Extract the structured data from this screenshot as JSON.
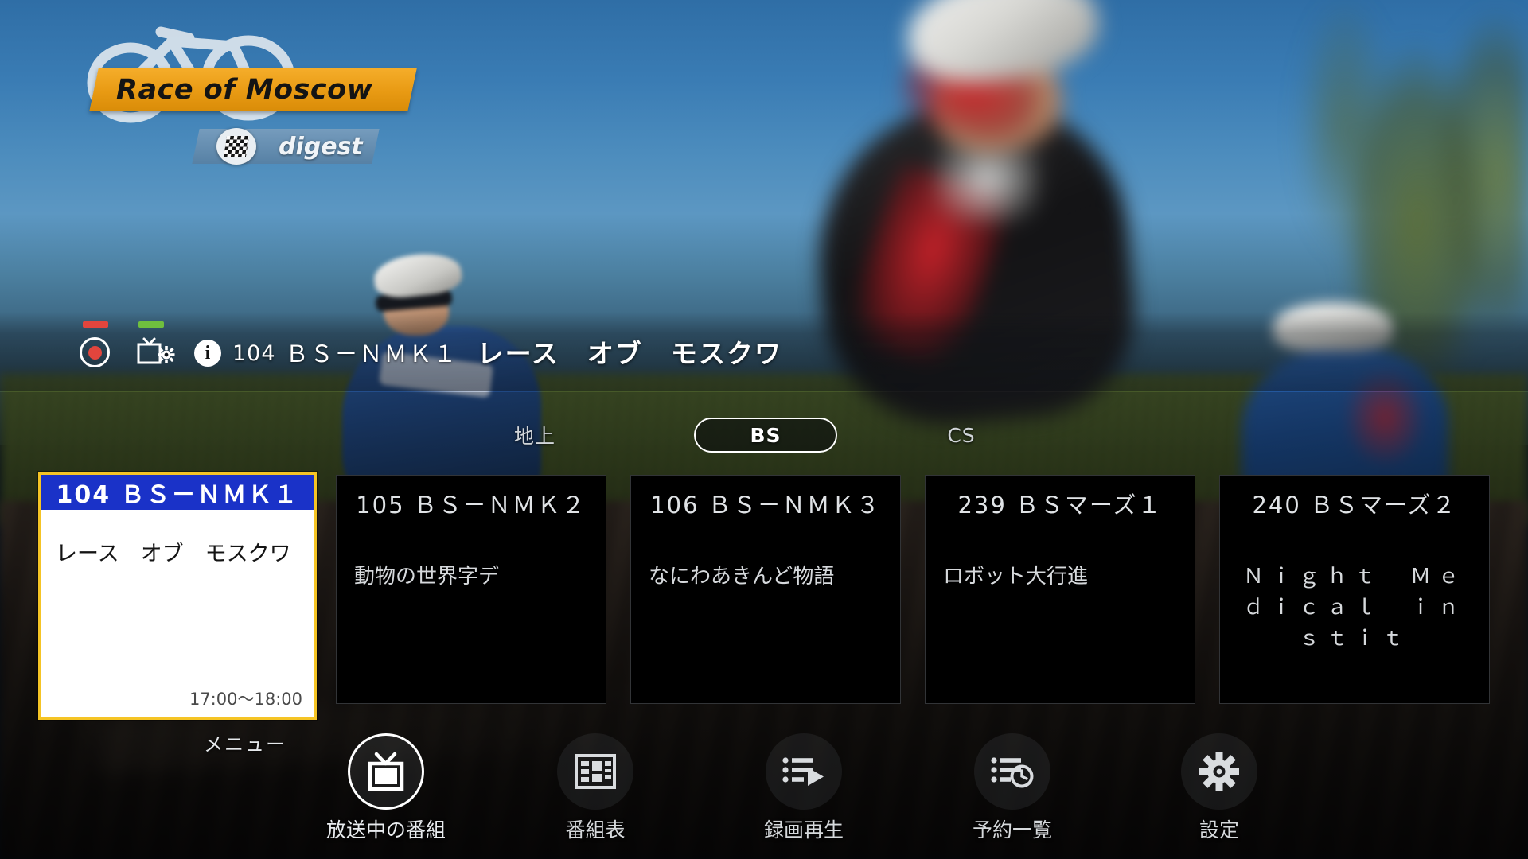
{
  "broadcast_logo": {
    "title": "Race of Moscow",
    "subtitle": "digest",
    "banner_color": "#e89a13",
    "flag_icon": "checkered-flag-icon",
    "bike_icon": "bicycle-icon"
  },
  "info_bar": {
    "record_icon": "record-indicator-icon",
    "record_bar_color": "#e2453d",
    "tuner_icon": "tv-settings-icon",
    "tuner_bar_color": "#6fbf3e",
    "info_icon": "info-icon",
    "channel_number": "104",
    "channel_name": "ＢＳ－ＮＭＫ１",
    "program_title": "レース　オブ　モスクワ"
  },
  "tabs": [
    {
      "label": "地上",
      "selected": false
    },
    {
      "label": "BS",
      "selected": true
    },
    {
      "label": "CS",
      "selected": false
    }
  ],
  "selected_card": {
    "channel_number": "104",
    "channel_name": "ＢＳ－ＮＭＫ１",
    "header_text": "104 ＢＳ－ＮＭＫ１",
    "program_title": "レース　オブ　モスクワ",
    "time_range": "17:00〜18:00",
    "header_bg": "#1a32c8",
    "border_color": "#f5c425"
  },
  "cards": [
    {
      "header_text": "105 ＢＳ－ＮＭＫ２",
      "program_title": "動物の世界字デ",
      "wide": false
    },
    {
      "header_text": "106 ＢＳ－ＮＭＫ３",
      "program_title": "なにわあきんど物語",
      "wide": false
    },
    {
      "header_text": "239 ＢＳマーズ１",
      "program_title": "ロボット大行進",
      "wide": false
    },
    {
      "header_text": "240 ＢＳマーズ２",
      "program_title": "Ｎｉｇｈｔ　Ｍｅｄｉｃａｌ　ｉｎｓｔｉｔ",
      "wide": true
    }
  ],
  "menu_label": "メニュー",
  "bottom_menu": [
    {
      "label": "放送中の番組",
      "icon": "tv-icon",
      "selected": true
    },
    {
      "label": "番組表",
      "icon": "program-grid-icon",
      "selected": false
    },
    {
      "label": "録画再生",
      "icon": "list-play-icon",
      "selected": false
    },
    {
      "label": "予約一覧",
      "icon": "list-clock-icon",
      "selected": false
    },
    {
      "label": "設定",
      "icon": "gear-icon",
      "selected": false
    }
  ]
}
